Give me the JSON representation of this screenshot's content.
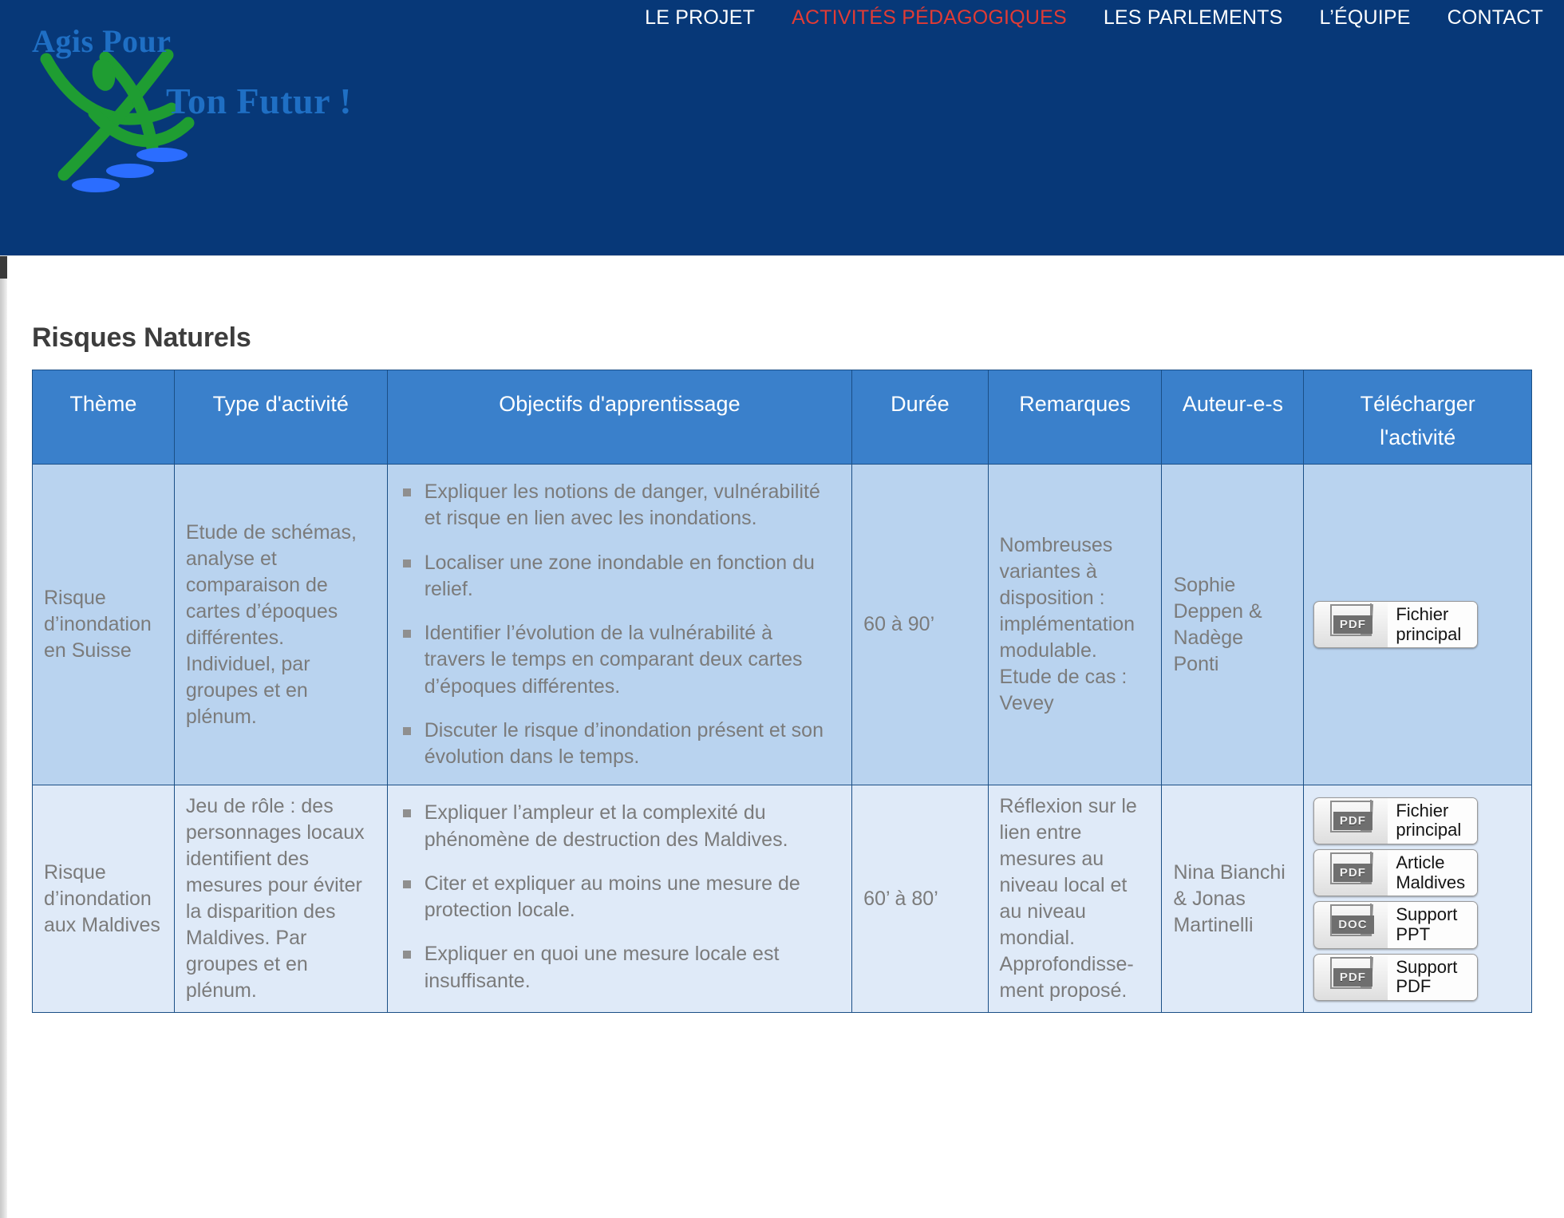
{
  "header": {
    "logo": {
      "line1": "Agis Pour",
      "line2": "Ton Futur !",
      "icon": "running-figure-logo"
    },
    "nav": [
      {
        "label": "LE PROJET",
        "active": false
      },
      {
        "label": "ACTIVITÉS PÉDAGOGIQUES",
        "active": true
      },
      {
        "label": "LES PARLEMENTS",
        "active": false
      },
      {
        "label": "L’ÉQUIPE",
        "active": false
      },
      {
        "label": "CONTACT",
        "active": false
      }
    ],
    "colors": {
      "background": "#073878",
      "nav_text": "#ffffff",
      "nav_active": "#e13b35",
      "logo_text": "#1f6fc4",
      "logo_green": "#1f9d32",
      "logo_blue": "#2b6dff"
    }
  },
  "page": {
    "title": "Risques Naturels"
  },
  "table": {
    "colors": {
      "header_bg": "#3a80cb",
      "header_text": "#ffffff",
      "border": "#1b4f86",
      "row_a_bg": "#b9d3ef",
      "row_b_bg": "#dfeaf8",
      "cell_text": "#7b7b7b"
    },
    "columns": [
      "Thème",
      "Type d'activité",
      "Objectifs d'apprentissage",
      "Durée",
      "Remarques",
      "Auteur-e-s",
      "Télécharger l'activité"
    ],
    "header_download_line1": "Télécharger",
    "header_download_line2": "l'activité",
    "rows": [
      {
        "theme": "Risque d’inondation en Suisse",
        "type": "Etude de schémas, analyse et comparaison de cartes d’époques différentes. Individuel, par groupes et en plénum.",
        "objectives": [
          "Expliquer les notions de danger, vulnérabilité et risque en lien avec les inondations.",
          "Localiser une zone inondable en fonction du relief.",
          "Identifier l’évolution de la vulnérabilité à travers le temps en comparant deux cartes d’époques différentes.",
          "Discuter le risque d’inondation présent et son évolution dans le temps."
        ],
        "duree": "60 à 90’",
        "remarques": "Nombreuses variantes à disposition : implémentation modulable. Etude de cas : Vevey",
        "auteurs": "Sophie Deppen & Nadège Ponti",
        "downloads": [
          {
            "type": "PDF",
            "label": "Fichier\nprincipal"
          }
        ]
      },
      {
        "theme": "Risque d’inondation aux Maldives",
        "type": "Jeu de rôle : des personnages locaux identifient des mesures pour éviter la disparition des Maldives. Par groupes et en plénum.",
        "objectives": [
          "Expliquer l’ampleur et la complexité du phénomène de destruction des Maldives.",
          "Citer et expliquer au moins une mesure de protection locale.",
          "Expliquer en quoi une mesure locale est insuffisante."
        ],
        "duree": "60’ à 80’",
        "remarques": "Réflexion sur le lien entre mesures au niveau local et au niveau mondial. Approfondisse-ment proposé.",
        "auteurs": "Nina Bianchi & Jonas Martinelli",
        "downloads": [
          {
            "type": "PDF",
            "label": "Fichier\nprincipal"
          },
          {
            "type": "PDF",
            "label": "Article\nMaldives"
          },
          {
            "type": "DOC",
            "label": "Support\nPPT"
          },
          {
            "type": "PDF",
            "label": "Support\nPDF"
          }
        ]
      }
    ]
  }
}
